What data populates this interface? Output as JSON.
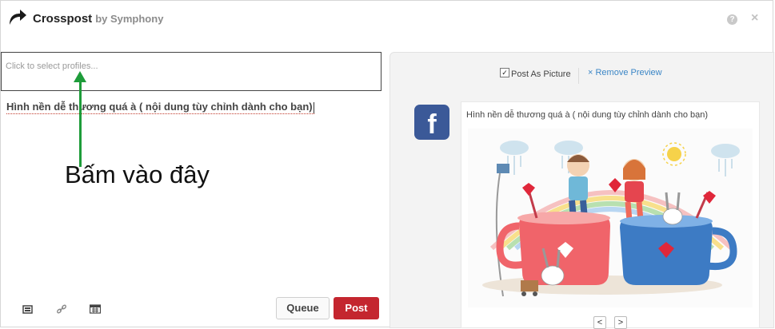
{
  "header": {
    "title": "Crosspost",
    "subtitle": "by Symphony",
    "help_label": "?",
    "close_label": "×"
  },
  "composer": {
    "profile_placeholder": "Click to select profiles...",
    "text": "Hình nền dễ thương quá à ( nội dung tùy chỉnh dành cho bạn)",
    "annotation": "Bấm vào đây"
  },
  "toolbar": {
    "icons": [
      "media-icon",
      "link-icon",
      "calendar-icon"
    ],
    "queue_label": "Queue",
    "post_label": "Post"
  },
  "preview": {
    "post_as_picture_label": "Post As Picture",
    "post_as_picture_checked": true,
    "remove_preview_label": "× Remove Preview",
    "network_icon": "f",
    "caption": "Hình nền dễ thương quá à ( nội dung tùy chỉnh dành cho bạn)",
    "prev_label": "<",
    "next_label": ">"
  },
  "colors": {
    "post_button": "#c4262f",
    "arrow": "#1e9c3a",
    "facebook": "#3b5998",
    "link": "#3b86c6"
  }
}
